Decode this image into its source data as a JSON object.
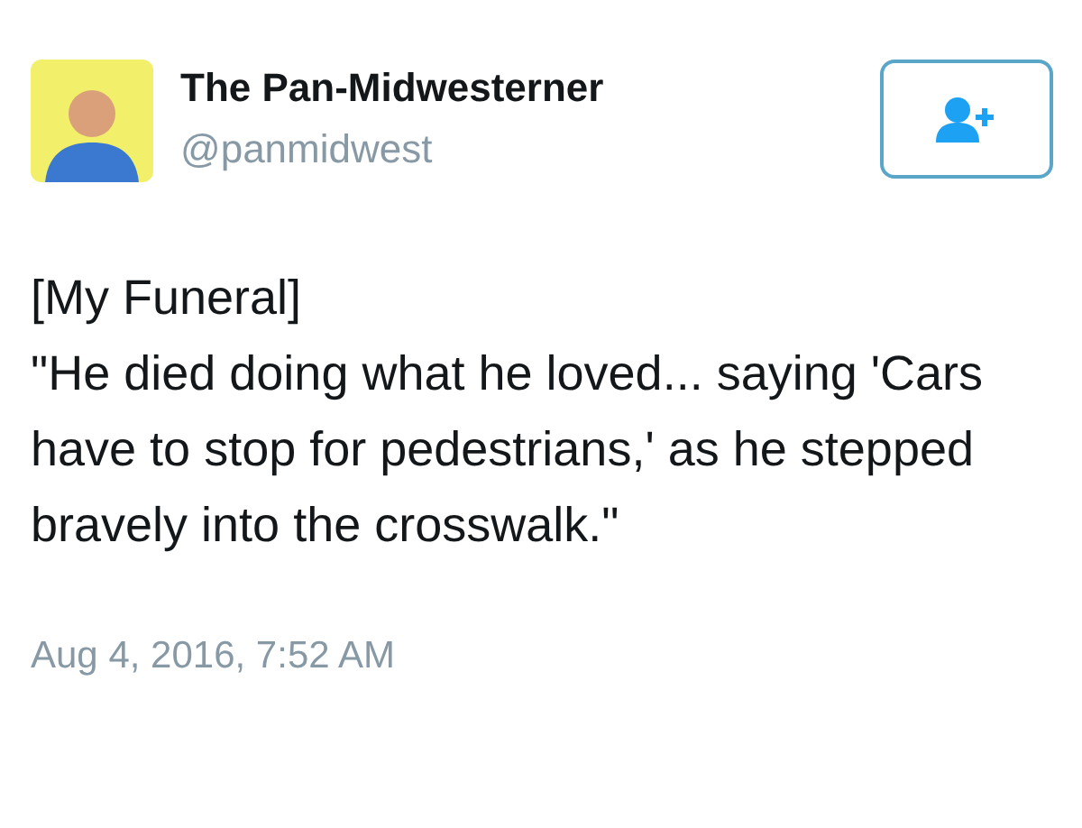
{
  "author": {
    "name": "The Pan-Midwesterner",
    "handle": "@panmidwest"
  },
  "tweet": {
    "paragraphs": [
      "[My Funeral]",
      "\"He died doing what he loved... saying 'Cars have to stop for pedestrians,' as he stepped bravely into the crosswalk.\""
    ],
    "timestamp": "Aug 4, 2016, 7:52 AM"
  }
}
